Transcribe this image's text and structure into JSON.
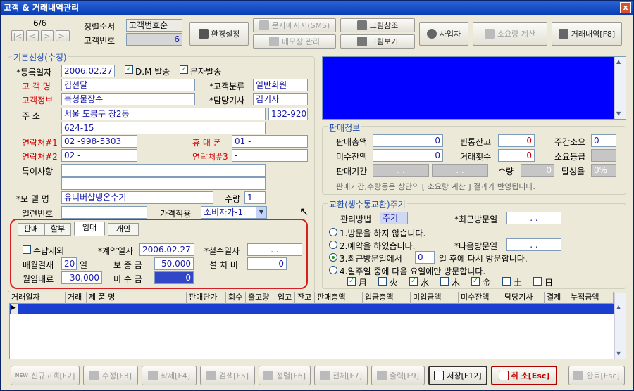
{
  "window": {
    "title": "고객 & 거래내역관리",
    "close_label": "x"
  },
  "nav": {
    "counter": "6/6",
    "sort_label": "정렬순서",
    "sort_value": "고객번호순",
    "custno_label": "고객번호",
    "custno_value": "6",
    "buttons": [
      "|<",
      "<",
      ">",
      ">|"
    ]
  },
  "toolbar": {
    "env": "환경설정",
    "sms": "문자메시지(SMS)",
    "memo": "메모장 관리",
    "pic_ref": "그림참조",
    "pic_view": "그림보기",
    "business": "사업자",
    "consume": "소요량 계산",
    "history": "거래내역[F8]"
  },
  "basic": {
    "group_title": "기본신상(수정)",
    "reg_date_label": "*등록일자",
    "reg_date": "2006.02.27",
    "dm_label": "D.M 발송",
    "dm_checked": "✓",
    "sms_label": "문자발송",
    "sms_checked": "✓",
    "name_label": "고 객 명",
    "name": "김선달",
    "cat_label": "*고객분류",
    "cat": "일반회원",
    "info_label": "고객정보",
    "info": "북청물장수",
    "rep_label": "*담당기사",
    "rep": "김기사",
    "addr_label": "주 소",
    "addr1": "서울 도봉구 창2동",
    "zip": "132-920",
    "addr2": "624-15",
    "tel1_label": "연락처#1",
    "tel1": "02 -998-5303",
    "mobile_label": "휴 대 폰",
    "mobile": "01 -",
    "tel2_label": "연락처#2",
    "tel2": "02 -",
    "tel3_label": "연락처#3",
    "tel3": "-",
    "memo_label": "특이사항",
    "model_label": "*모 델 명",
    "model": "유니버샬냉온수기",
    "qty_label": "수량",
    "qty": "1",
    "serial_label": "일련번호",
    "serial": "",
    "price_label": "가격적용",
    "price": "소비자가-1"
  },
  "rental": {
    "tabs": [
      "판매",
      "할부",
      "임대",
      "개인"
    ],
    "payexcl_label": "수납제외",
    "contract_label": "*계약일자",
    "contract": "2006.02.27",
    "withdraw_label": "*철수일자",
    "withdraw": ". .",
    "monthly_label": "매월결재",
    "monthly_day": "20",
    "day_unit": "일",
    "deposit_label": "보 증 금",
    "deposit": "50,000",
    "install_label": "설 치 비",
    "install": "0",
    "fee_label": "월임대료",
    "fee": "30,000",
    "unpaid_label": "미 수 금",
    "unpaid": "0"
  },
  "sales": {
    "group_title": "판매정보",
    "total_label": "판매총액",
    "total": "0",
    "empty_label": "빈통잔고",
    "empty": "0",
    "week_label": "주간소요",
    "week": "0",
    "unrecv_label": "미수잔액",
    "unrecv": "0",
    "count_label": "거래횟수",
    "count": "0",
    "grade_label": "소요등급",
    "grade": "",
    "period_label": "판매기간",
    "period_from": ". .",
    "period_to": ". .",
    "qty_label": "수량",
    "qty": "0",
    "rate_label": "달성율",
    "rate": "0%",
    "note": "판매기간,수량등은 상단의 [ 소요량 계산 ] 결과가 반영됩니다."
  },
  "exchange": {
    "group_title": "교환(생수통교환)주기",
    "method_label": "관리방법",
    "method": "주기",
    "lastvisit_label": "*최근방문일",
    "lastvisit": ". .",
    "opt1": "1.방문을 하지 않습니다.",
    "opt2": "2.예약을 하였습니다.",
    "nextvisit_label": "*다음방문일",
    "nextvisit": ". .",
    "opt3_a": "3.최근방문일에서",
    "opt3_days": "0",
    "opt3_b": "일 후에 다시 방문합니다.",
    "opt4": "4.일주일 중에 다음 요일에만 방문합니다.",
    "days": [
      {
        "label": "月",
        "mark": "✓"
      },
      {
        "label": "火",
        "mark": ""
      },
      {
        "label": "水",
        "mark": "✓"
      },
      {
        "label": "木",
        "mark": ""
      },
      {
        "label": "金",
        "mark": "✓"
      },
      {
        "label": "土",
        "mark": ""
      },
      {
        "label": "日",
        "mark": ""
      }
    ]
  },
  "grid": {
    "columns": [
      "거래일자",
      "거래",
      "제 품 명",
      "판매단가",
      "회수",
      "출고량",
      "입고",
      "잔고",
      "판매총액",
      "입금총액",
      "미입금액",
      "미수잔액",
      "담당기사",
      "결제",
      "누적금액"
    ]
  },
  "bottom": {
    "new_tag": "NEW",
    "new": "신규고객[F2]",
    "edit": "수정[F3]",
    "delete": "삭제[F4]",
    "search": "검색[F5]",
    "sort": "정렬[F6]",
    "all": "전체[F7]",
    "print": "출력[F9]",
    "save": "저장[F12]",
    "cancel": "취 소[Esc]",
    "done": "완료[Esc]"
  },
  "colors": {
    "title_bar": "#0a3db4",
    "label_red": "#d40000",
    "panel_blue": "#0000ff",
    "grid_select": "#1a3fd0",
    "rental_border": "#d42020"
  }
}
